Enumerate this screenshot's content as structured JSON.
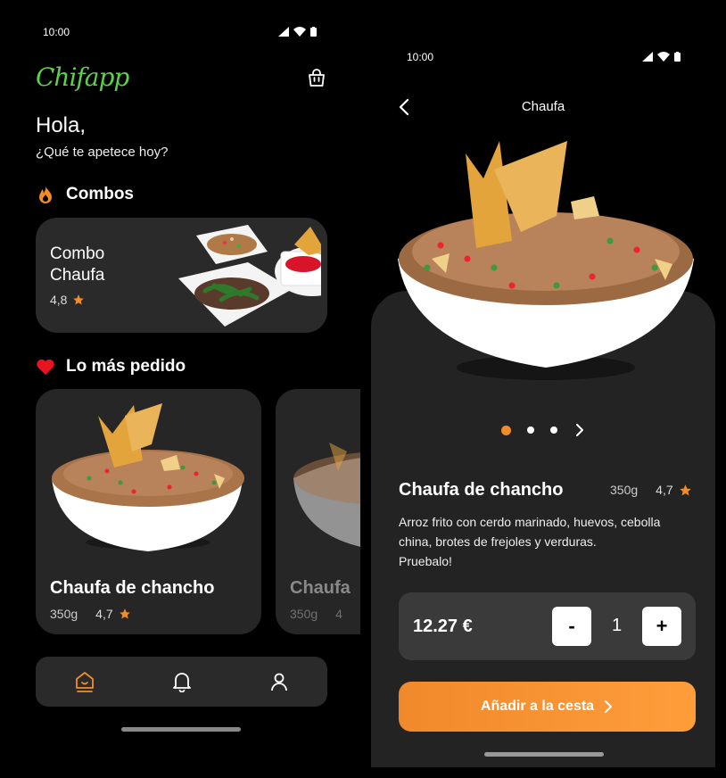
{
  "home": {
    "status_time": "10:00",
    "logo": "Chifapp",
    "greeting": "Hola,",
    "question": "¿Qué te apetece hoy?",
    "combos_title": "Combos",
    "combo": {
      "name": "Combo Chaufa",
      "rating": "4,8"
    },
    "popular_title": "Lo más pedido",
    "cards": [
      {
        "name": "Chaufa de chancho",
        "weight": "350g",
        "rating": "4,7"
      },
      {
        "name": "Chaufa",
        "weight": "350g",
        "rating": "4"
      }
    ],
    "nav": [
      "home-icon",
      "bell-icon",
      "user-icon"
    ]
  },
  "detail": {
    "status_time": "10:00",
    "title": "Chaufa",
    "name": "Chaufa de chancho",
    "weight": "350g",
    "rating": "4,7",
    "description_lines": [
      "Arroz frito con cerdo marinado, huevos, cebolla",
      "china, brotes de frejoles y verduras.",
      "Pruebalo!"
    ],
    "price": "12.27 €",
    "quantity": "1",
    "minus": "-",
    "plus": "+",
    "add_button": "Añadir a la cesta",
    "carousel_pages": 3,
    "carousel_active": 1
  },
  "colors": {
    "accent": "#f28c28",
    "logo": "#5fd04a",
    "heart": "#e8131c"
  }
}
